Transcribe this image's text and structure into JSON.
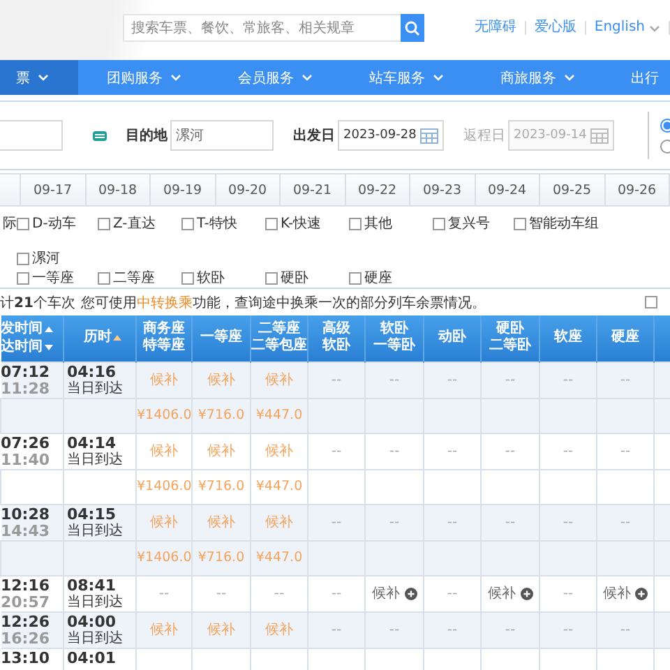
{
  "top_bar": {
    "search": {
      "placeholder": "搜索车票、餐饮、常旅客、相关规章"
    },
    "links": [
      {
        "label": "无障碍",
        "dropdown": false
      },
      {
        "label": "爱心版",
        "dropdown": false
      },
      {
        "label": "English",
        "dropdown": true
      }
    ]
  },
  "nav": [
    {
      "label": "票",
      "selected": true,
      "dropdown": true
    },
    {
      "label": "团购服务",
      "selected": false,
      "dropdown": true
    },
    {
      "label": "会员服务",
      "selected": false,
      "dropdown": true
    },
    {
      "label": "站车服务",
      "selected": false,
      "dropdown": true
    },
    {
      "label": "商旅服务",
      "selected": false,
      "dropdown": true
    },
    {
      "label": "出行",
      "selected": false,
      "dropdown": false
    }
  ],
  "query": {
    "to": {
      "label": "目的地",
      "value": "漯河"
    },
    "depart": {
      "label": "出发日",
      "value": "2023-09-28",
      "disabled": false
    },
    "return": {
      "label": "返程日",
      "value": "2023-09-14",
      "disabled": true
    },
    "trip_options": [
      {
        "selected": true
      },
      {
        "selected": false
      }
    ]
  },
  "date_tabs": [
    {
      "label": "09-17",
      "selected": false
    },
    {
      "label": "09-18",
      "selected": false
    },
    {
      "label": "09-19",
      "selected": false
    },
    {
      "label": "09-20",
      "selected": false
    },
    {
      "label": "09-21",
      "selected": false
    },
    {
      "label": "09-22",
      "selected": false
    },
    {
      "label": "09-23",
      "selected": false
    },
    {
      "label": "09-24",
      "selected": false
    },
    {
      "label": "09-25",
      "selected": false
    },
    {
      "label": "09-26",
      "selected": false
    }
  ],
  "train_types": [
    {
      "label": "际"
    },
    {
      "label": "D-动车",
      "checked": false
    },
    {
      "label": "Z-直达",
      "checked": false
    },
    {
      "label": "T-特快",
      "checked": false
    },
    {
      "label": "K-快速",
      "checked": false
    },
    {
      "label": "其他",
      "checked": false
    },
    {
      "label": "复兴号",
      "checked": false
    },
    {
      "label": "智能动车组",
      "checked": false
    }
  ],
  "stations": [
    {
      "label": "漯河",
      "checked": false
    }
  ],
  "seat_types": [
    {
      "label": "一等座",
      "checked": false
    },
    {
      "label": "二等座",
      "checked": false
    },
    {
      "label": "软卧",
      "checked": false
    },
    {
      "label": "硬卧",
      "checked": false
    },
    {
      "label": "硬座",
      "checked": false
    }
  ],
  "summary": "计**21**个车次",
  "notice": {
    "before": "您可使用",
    "link": "中转换乘",
    "after": "功能，查询途中换乘一次的部分列车余票情况。"
  },
  "option_checkbox": {
    "checked": false
  },
  "table": {
    "columns": [
      {
        "kind": "sortable",
        "labels": [
          {
            "text": "发时间",
            "ascending": true,
            "active": false
          },
          {
            "text": "达时间",
            "ascending": false,
            "active": false
          }
        ]
      },
      {
        "kind": "sortable",
        "labels": [
          {
            "text": "历时",
            "ascending": true,
            "active": true
          }
        ]
      },
      {
        "kind": "plain",
        "lines": [
          "商务座",
          "特等座"
        ]
      },
      {
        "kind": "plain",
        "lines": [
          "一等座"
        ]
      },
      {
        "kind": "plain",
        "lines": [
          "二等座",
          "二等包座"
        ]
      },
      {
        "kind": "plain",
        "lines": [
          "高级",
          "软卧"
        ]
      },
      {
        "kind": "plain",
        "lines": [
          "软卧",
          "一等卧"
        ]
      },
      {
        "kind": "plain",
        "lines": [
          "动卧"
        ]
      },
      {
        "kind": "plain",
        "lines": [
          "硬卧",
          "二等卧"
        ]
      },
      {
        "kind": "plain",
        "lines": [
          "软座"
        ]
      },
      {
        "kind": "plain",
        "lines": [
          "硬座"
        ]
      }
    ],
    "rows": [
      {
        "cells": [
          {
            "kind": "times",
            "depart": "07:12",
            "arrive": "11:28"
          },
          {
            "kind": "duration",
            "text": "04:16",
            "arrival_day": "当日到达"
          },
          {
            "kind": "waitlist",
            "text": "候补",
            "price": "¥1406.0"
          },
          {
            "kind": "waitlist",
            "text": "候补",
            "price": "¥716.0"
          },
          {
            "kind": "waitlist",
            "text": "候补",
            "price": "¥447.0"
          },
          {
            "kind": "none",
            "text": "--"
          },
          {
            "kind": "none",
            "text": "--"
          },
          {
            "kind": "none",
            "text": "--"
          },
          {
            "kind": "none",
            "text": "--"
          },
          {
            "kind": "none",
            "text": "--"
          },
          {
            "kind": "none",
            "text": "--"
          }
        ]
      },
      {
        "cells": [
          {
            "kind": "times",
            "depart": "07:26",
            "arrive": "11:40"
          },
          {
            "kind": "duration",
            "text": "04:14",
            "arrival_day": "当日到达"
          },
          {
            "kind": "waitlist",
            "text": "候补",
            "price": "¥1406.0"
          },
          {
            "kind": "waitlist",
            "text": "候补",
            "price": "¥716.0"
          },
          {
            "kind": "waitlist",
            "text": "候补",
            "price": "¥447.0"
          },
          {
            "kind": "none",
            "text": "--"
          },
          {
            "kind": "none",
            "text": "--"
          },
          {
            "kind": "none",
            "text": "--"
          },
          {
            "kind": "none",
            "text": "--"
          },
          {
            "kind": "none",
            "text": "--"
          },
          {
            "kind": "none",
            "text": "--"
          }
        ]
      },
      {
        "cells": [
          {
            "kind": "times",
            "depart": "10:28",
            "arrive": "14:43"
          },
          {
            "kind": "duration",
            "text": "04:15",
            "arrival_day": "当日到达"
          },
          {
            "kind": "waitlist",
            "text": "候补",
            "price": "¥1406.0"
          },
          {
            "kind": "waitlist",
            "text": "候补",
            "price": "¥716.0"
          },
          {
            "kind": "waitlist",
            "text": "候补",
            "price": "¥447.0"
          },
          {
            "kind": "none",
            "text": "--"
          },
          {
            "kind": "none",
            "text": "--"
          },
          {
            "kind": "none",
            "text": "--"
          },
          {
            "kind": "none",
            "text": "--"
          },
          {
            "kind": "none",
            "text": "--"
          },
          {
            "kind": "none",
            "text": "--"
          }
        ]
      },
      {
        "cells": [
          {
            "kind": "times",
            "depart": "12:16",
            "arrive": "20:57"
          },
          {
            "kind": "duration",
            "text": "08:41",
            "arrival_day": "当日到达"
          },
          {
            "kind": "none",
            "text": "--"
          },
          {
            "kind": "none",
            "text": "--"
          },
          {
            "kind": "none",
            "text": "--"
          },
          {
            "kind": "none",
            "text": "--"
          },
          {
            "kind": "waitlist_add",
            "text": "候补"
          },
          {
            "kind": "none",
            "text": "--"
          },
          {
            "kind": "waitlist_add",
            "text": "候补"
          },
          {
            "kind": "none",
            "text": "--"
          },
          {
            "kind": "waitlist_add",
            "text": "候补"
          }
        ]
      },
      {
        "cells": [
          {
            "kind": "times",
            "depart": "12:26",
            "arrive": "16:26"
          },
          {
            "kind": "duration",
            "text": "04:00",
            "arrival_day": "当日到达"
          },
          {
            "kind": "waitlist",
            "text": "候补"
          },
          {
            "kind": "waitlist",
            "text": "候补"
          },
          {
            "kind": "waitlist",
            "text": "候补"
          },
          {
            "kind": "none",
            "text": "--"
          },
          {
            "kind": "none",
            "text": "--"
          },
          {
            "kind": "none",
            "text": "--"
          },
          {
            "kind": "none",
            "text": "--"
          },
          {
            "kind": "none",
            "text": "--"
          },
          {
            "kind": "none",
            "text": "--"
          }
        ]
      },
      {
        "cells": [
          {
            "kind": "times",
            "depart": "13:10"
          },
          {
            "kind": "duration",
            "text": "04:01"
          }
        ]
      }
    ]
  }
}
